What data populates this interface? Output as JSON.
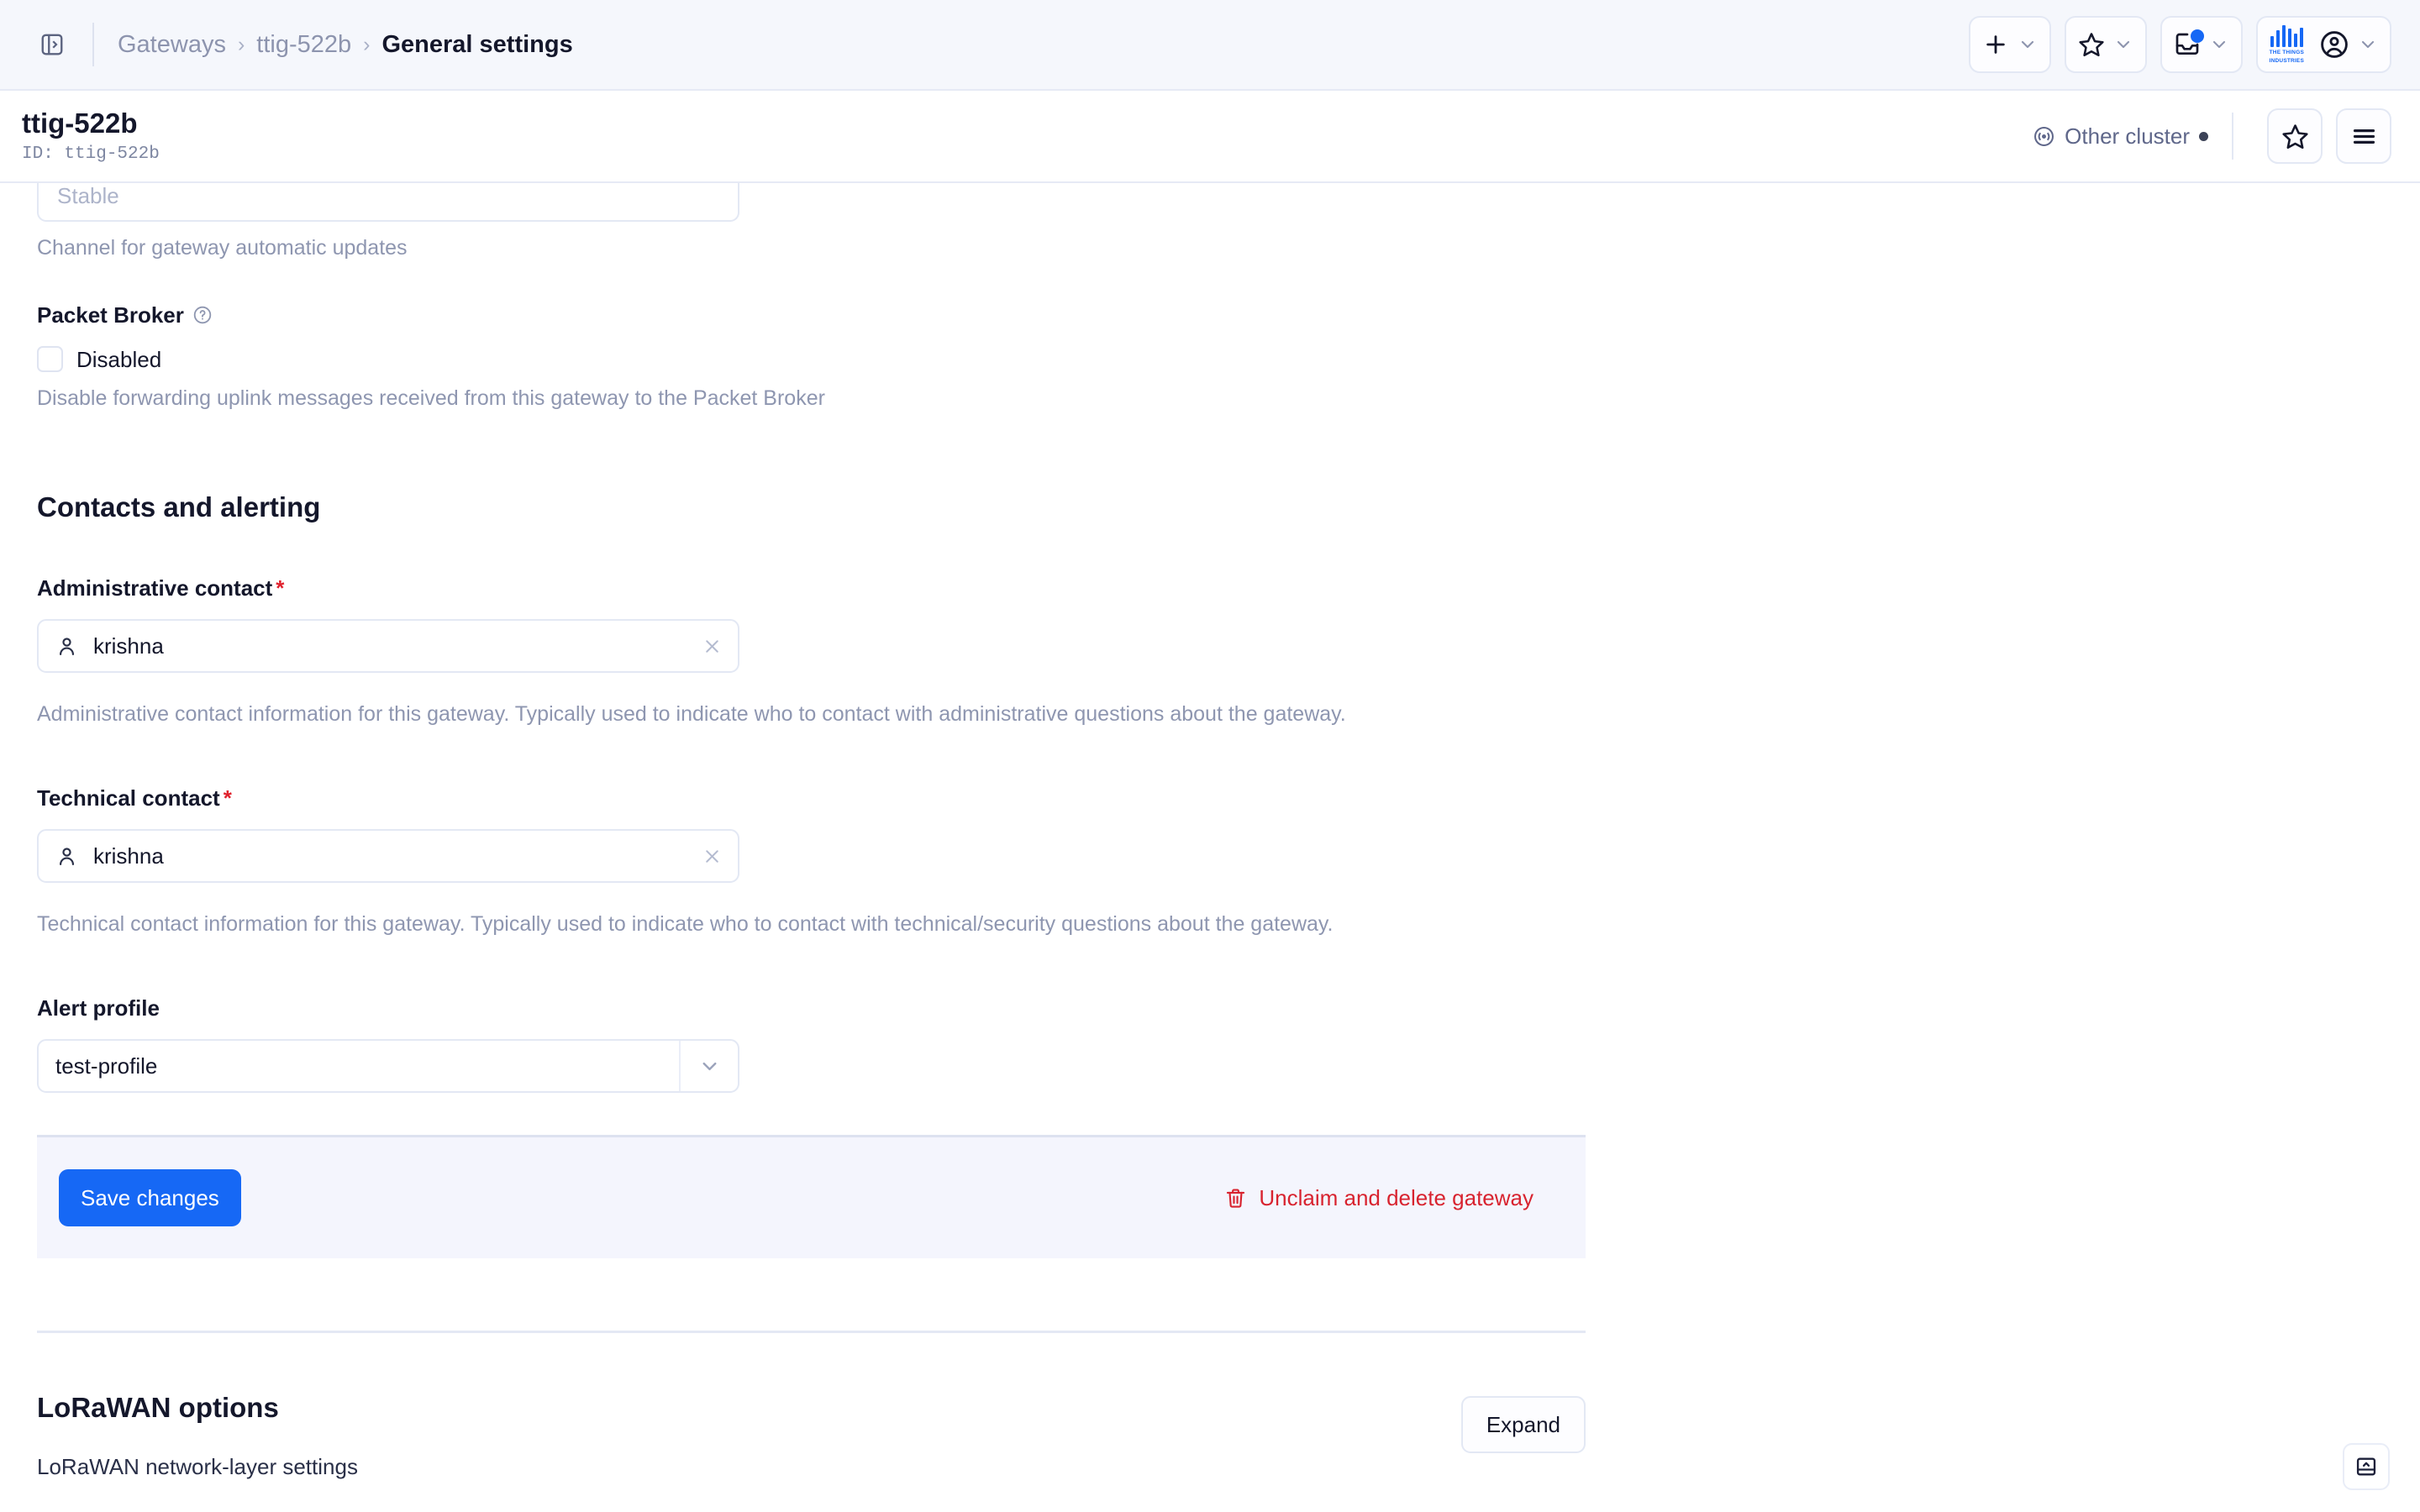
{
  "topbar": {
    "panel_toggle": "sidebar-toggle",
    "breadcrumb": [
      {
        "label": "Gateways",
        "current": false
      },
      {
        "label": "ttig-522b",
        "current": false
      },
      {
        "label": "General settings",
        "current": true
      }
    ],
    "separator": "›",
    "actions": [
      {
        "name": "add",
        "icon": "plus-icon",
        "has_chevron": true,
        "has_badge": false
      },
      {
        "name": "bookmarks",
        "icon": "star-icon",
        "has_chevron": true,
        "has_badge": false
      },
      {
        "name": "notifications",
        "icon": "inbox-icon",
        "has_chevron": true,
        "has_badge": true
      },
      {
        "name": "account",
        "icon": "user-circle-icon",
        "has_chevron": true,
        "has_badge": false
      }
    ],
    "logo": {
      "name": "tti-logo",
      "line1": "THE THINGS",
      "line2": "INDUSTRIES",
      "color": "#1668f5"
    }
  },
  "page_header": {
    "title": "ttig-522b",
    "id_label": "ID: ttig-522b",
    "cluster": {
      "label": "Other cluster",
      "icon": "broadcast-icon",
      "status_dot": "#3c4257"
    },
    "buttons": [
      {
        "name": "bookmark-toggle",
        "icon": "star-icon"
      },
      {
        "name": "page-menu",
        "icon": "hamburger-icon"
      }
    ]
  },
  "form": {
    "update_channel": {
      "placeholder": "Stable",
      "help": "Channel for gateway automatic updates"
    },
    "packet_broker": {
      "label": "Packet Broker",
      "help_icon": "question-circle-icon",
      "checkbox_label": "Disabled",
      "checked": false,
      "help": "Disable forwarding uplink messages received from this gateway to the Packet Broker"
    },
    "contacts_section": {
      "title": "Contacts and alerting",
      "administrative_contact": {
        "label": "Administrative contact",
        "required_marker": "*",
        "value": "krishna",
        "icon": "person-icon",
        "clear_icon": "close-icon",
        "help": "Administrative contact information for this gateway. Typically used to indicate who to contact with administrative questions about the gateway."
      },
      "technical_contact": {
        "label": "Technical contact",
        "required_marker": "*",
        "value": "krishna",
        "icon": "person-icon",
        "clear_icon": "close-icon",
        "help": "Technical contact information for this gateway. Typically used to indicate who to contact with technical/security questions about the gateway."
      },
      "alert_profile": {
        "label": "Alert profile",
        "value": "test-profile",
        "caret_icon": "chevron-down-icon"
      }
    },
    "actions": {
      "save_label": "Save changes",
      "save_color": "#1668f5",
      "delete_label": "Unclaim and delete gateway",
      "delete_icon": "trash-icon",
      "delete_color": "#d8232f"
    }
  },
  "lorawan": {
    "title": "LoRaWAN options",
    "subtitle": "LoRaWAN network-layer settings",
    "expand_label": "Expand"
  },
  "float_button": {
    "name": "expand-panel",
    "icon": "panel-up-icon"
  }
}
